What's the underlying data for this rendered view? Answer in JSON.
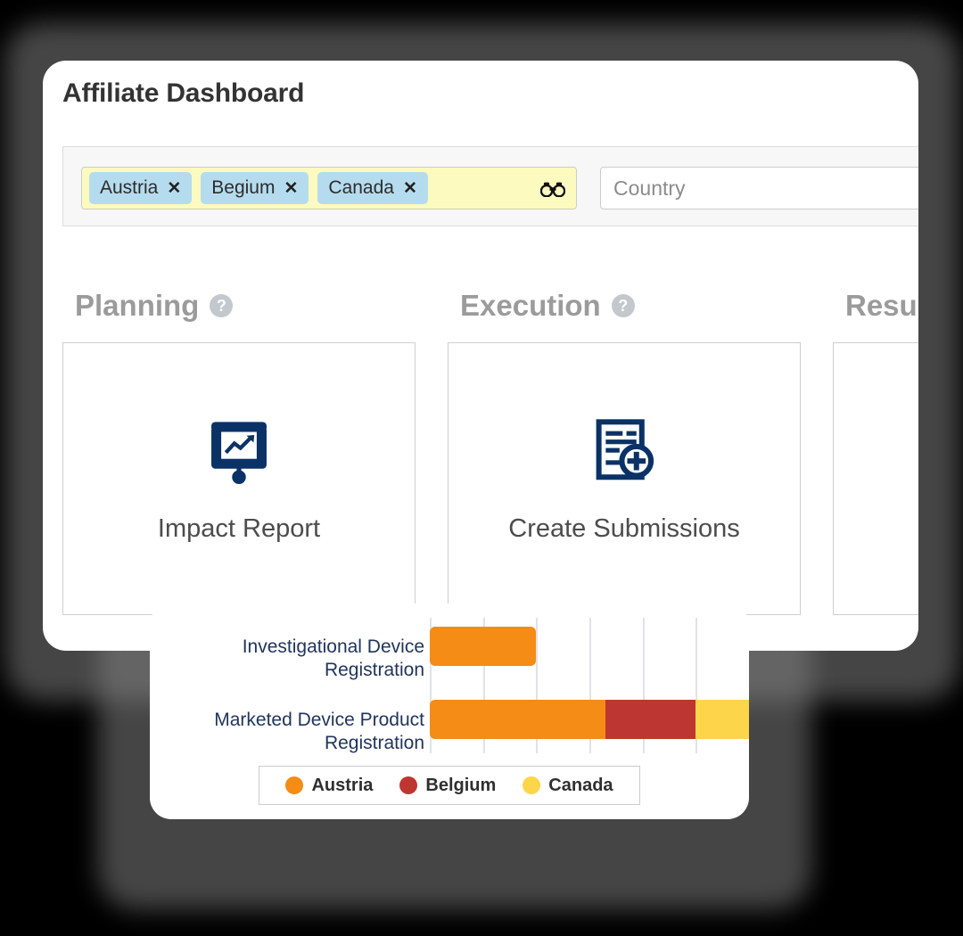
{
  "header": {
    "title": "Affiliate Dashboard"
  },
  "filters": {
    "multiselect": {
      "name": "affiliate-multiselect",
      "icon": "binoculars-icon",
      "chips": [
        {
          "label": "Austria",
          "remove": "✕"
        },
        {
          "label": "Begium",
          "remove": "✕"
        },
        {
          "label": "Canada",
          "remove": "✕"
        }
      ]
    },
    "country": {
      "name": "country-search-input",
      "placeholder": "Country",
      "value": "",
      "icon": "binoculars-icon"
    }
  },
  "sections": [
    {
      "title": "Planning",
      "help": "?",
      "tile": {
        "label": "Impact Report",
        "icon": "presentation-chart-icon"
      }
    },
    {
      "title": "Execution",
      "help": "?",
      "tile": {
        "label": "Create\nSubmissions",
        "icon": "document-add-icon"
      }
    },
    {
      "title": "Results",
      "help": "?",
      "tile": {
        "label": "",
        "icon": ""
      }
    }
  ],
  "chart_data": {
    "type": "bar",
    "orientation": "horizontal",
    "stacked": true,
    "title": "",
    "xlabel": "",
    "ylabel": "",
    "categories": [
      "Investigational Device Registration",
      "Marketed Device Product Registration"
    ],
    "series": [
      {
        "name": "Austria",
        "color": "#F48C16",
        "values": [
          2,
          3.3
        ]
      },
      {
        "name": "Belgium",
        "color": "#BE3632",
        "values": [
          0,
          1.7
        ]
      },
      {
        "name": "Canada",
        "color": "#FCD54A",
        "values": [
          0,
          1.0
        ]
      }
    ],
    "xlim": [
      0,
      6
    ],
    "xticks": [
      0,
      1,
      2,
      3,
      4,
      5,
      6
    ],
    "grid": true,
    "legend_position": "bottom",
    "legend": [
      "Austria",
      "Belgium",
      "Canada"
    ],
    "note": "Second bar is clipped by the card edge"
  },
  "colors": {
    "austria": "#F48C16",
    "belgium": "#BE3632",
    "canada": "#FCD54A",
    "icon_navy": "#0B3266",
    "label_navy": "#21355C",
    "chip_blue": "#B5DCEE",
    "multiselect_yellow": "#FCFABF"
  }
}
